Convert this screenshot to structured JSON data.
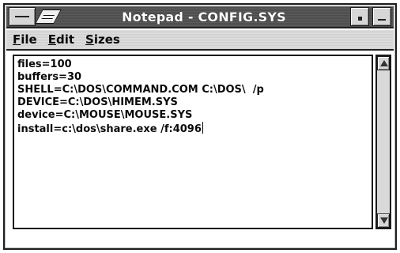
{
  "window": {
    "title": "Notepad - CONFIG.SYS"
  },
  "menubar": {
    "items": [
      {
        "accelerator": "F",
        "rest": "ile"
      },
      {
        "accelerator": "E",
        "rest": "dit"
      },
      {
        "accelerator": "S",
        "rest": "izes"
      }
    ]
  },
  "document": {
    "lines": [
      "files=100",
      "buffers=30",
      "SHELL=C:\\DOS\\COMMAND.COM C:\\DOS\\  /p",
      "DEVICE=C:\\DOS\\HIMEM.SYS",
      "device=C:\\MOUSE\\MOUSE.SYS",
      "install=c:\\dos\\share.exe /f:4096"
    ]
  }
}
